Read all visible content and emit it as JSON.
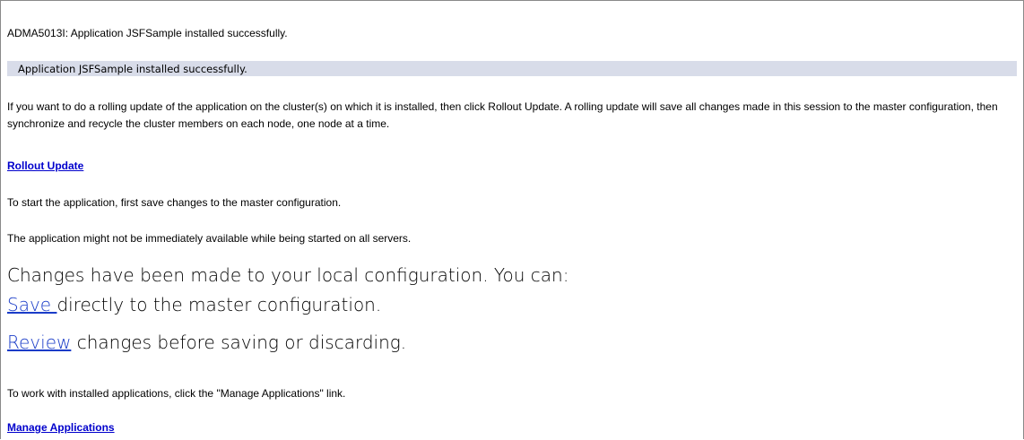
{
  "messages": {
    "message_id_line": "ADMA5013I: Application JSFSample installed successfully.",
    "banner_text": "Application JSFSample installed successfully.",
    "rolling_update_info": "If you want to do a rolling update of the application on the cluster(s) on which it is installed, then click Rollout Update. A rolling update will save all changes made in this session to the master configuration, then synchronize and recycle the cluster members on each node, one node at a time.",
    "rollout_link": "Rollout Update",
    "start_info": "To start the application, first save changes to the master configuration.",
    "availability_info": "The application might not be immediately available while being started on all servers."
  },
  "changes": {
    "heading": "Changes have been made to your local configuration. You can:",
    "save_link": "Save ",
    "save_suffix": "directly to the master configuration.",
    "review_link": "Review",
    "review_suffix": " changes before saving or discarding."
  },
  "manage": {
    "info": "To work with installed applications, click the \"Manage Applications\" link.",
    "link": "Manage Applications"
  },
  "colors": {
    "banner_background": "#d8dce9",
    "link": "#0000cc",
    "frame_border": "#8a8a8a"
  }
}
